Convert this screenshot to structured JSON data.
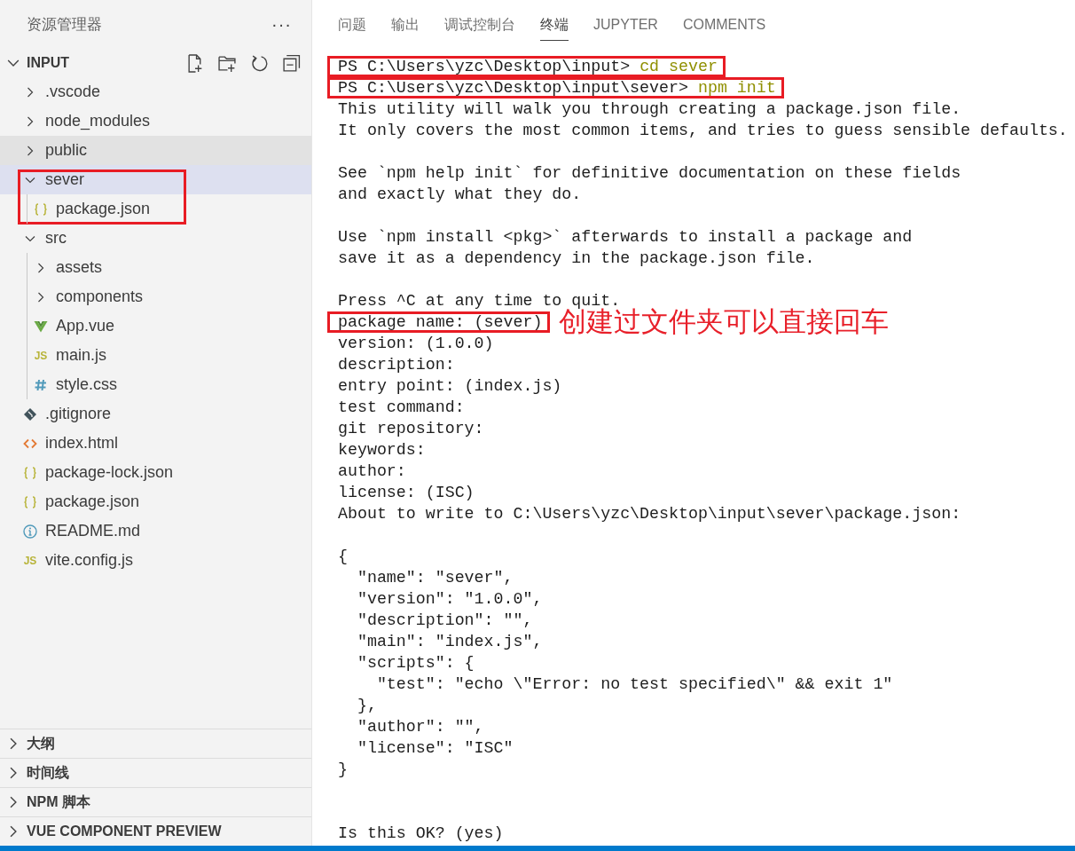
{
  "sidebar": {
    "title": "资源管理器",
    "more": "···",
    "folder": {
      "label": "INPUT",
      "expanded": true
    },
    "tree": [
      {
        "label": ".vscode",
        "kind": "folder",
        "expanded": false,
        "selected": false,
        "hovered": false,
        "boxed": false
      },
      {
        "label": "node_modules",
        "kind": "folder",
        "expanded": false,
        "selected": false,
        "hovered": false,
        "boxed": false
      },
      {
        "label": "public",
        "kind": "folder",
        "expanded": false,
        "selected": false,
        "hovered": true,
        "boxed": false
      },
      {
        "label": "sever",
        "kind": "folder",
        "expanded": true,
        "selected": true,
        "hovered": false,
        "boxed": true,
        "children": [
          {
            "label": "package.json",
            "kind": "json",
            "selected": false,
            "hovered": false,
            "boxed": false
          }
        ]
      },
      {
        "label": "src",
        "kind": "folder",
        "expanded": true,
        "selected": false,
        "hovered": false,
        "boxed": false,
        "children": [
          {
            "label": "assets",
            "kind": "folder",
            "expanded": false,
            "selected": false,
            "hovered": false,
            "boxed": false
          },
          {
            "label": "components",
            "kind": "folder",
            "expanded": false,
            "selected": false,
            "hovered": false,
            "boxed": false
          },
          {
            "label": "App.vue",
            "kind": "vue",
            "selected": false,
            "hovered": false,
            "boxed": false
          },
          {
            "label": "main.js",
            "kind": "js",
            "icon_text": "JS",
            "selected": false,
            "hovered": false,
            "boxed": false
          },
          {
            "label": "style.css",
            "kind": "css",
            "selected": false,
            "hovered": false,
            "boxed": false
          }
        ]
      },
      {
        "label": ".gitignore",
        "kind": "git",
        "selected": false,
        "hovered": false,
        "boxed": false
      },
      {
        "label": "index.html",
        "kind": "html",
        "selected": false,
        "hovered": false,
        "boxed": false
      },
      {
        "label": "package-lock.json",
        "kind": "json",
        "selected": false,
        "hovered": false,
        "boxed": false
      },
      {
        "label": "package.json",
        "kind": "json",
        "selected": false,
        "hovered": false,
        "boxed": false
      },
      {
        "label": "README.md",
        "kind": "info",
        "selected": false,
        "hovered": false,
        "boxed": false
      },
      {
        "label": "vite.config.js",
        "kind": "js",
        "icon_text": "JS",
        "selected": false,
        "hovered": false,
        "boxed": false
      }
    ],
    "sections": [
      {
        "label": "大纲",
        "expanded": false
      },
      {
        "label": "时间线",
        "expanded": false
      },
      {
        "label": "NPM 脚本",
        "expanded": false
      },
      {
        "label": "VUE COMPONENT PREVIEW",
        "expanded": false
      }
    ]
  },
  "panel": {
    "tabs": [
      {
        "label": "问题",
        "selected": false
      },
      {
        "label": "输出",
        "selected": false
      },
      {
        "label": "调试控制台",
        "selected": false
      },
      {
        "label": "终端",
        "selected": true
      },
      {
        "label": "JUPYTER",
        "selected": false
      },
      {
        "label": "COMMENTS",
        "selected": false
      }
    ],
    "lines": [
      {
        "kind": "prompt",
        "text": "PS C:\\Users\\yzc\\Desktop\\input>",
        "command": "cd sever",
        "boxed": true
      },
      {
        "kind": "prompt",
        "text": "PS C:\\Users\\yzc\\Desktop\\input\\sever>",
        "command": "npm init",
        "boxed": true
      },
      {
        "kind": "text",
        "text": "This utility will walk you through creating a package.json file.",
        "boxed": false
      },
      {
        "kind": "text",
        "text": "It only covers the most common items, and tries to guess sensible defaults.",
        "boxed": false
      },
      {
        "kind": "blank"
      },
      {
        "kind": "text",
        "text": "See `npm help init` for definitive documentation on these fields",
        "boxed": false
      },
      {
        "kind": "text",
        "text": "and exactly what they do.",
        "boxed": false
      },
      {
        "kind": "blank"
      },
      {
        "kind": "text",
        "text": "Use `npm install <pkg>` afterwards to install a package and",
        "boxed": false
      },
      {
        "kind": "text",
        "text": "save it as a dependency in the package.json file.",
        "boxed": false
      },
      {
        "kind": "blank"
      },
      {
        "kind": "text",
        "text": "Press ^C at any time to quit.",
        "boxed": false
      },
      {
        "kind": "text",
        "text": "package name: (sever)",
        "boxed": true,
        "note": "创建过文件夹可以直接回车"
      },
      {
        "kind": "text",
        "text": "version: (1.0.0)",
        "boxed": false
      },
      {
        "kind": "text",
        "text": "description:",
        "boxed": false
      },
      {
        "kind": "text",
        "text": "entry point: (index.js)",
        "boxed": false
      },
      {
        "kind": "text",
        "text": "test command:",
        "boxed": false
      },
      {
        "kind": "text",
        "text": "git repository:",
        "boxed": false
      },
      {
        "kind": "text",
        "text": "keywords:",
        "boxed": false
      },
      {
        "kind": "text",
        "text": "author:",
        "boxed": false
      },
      {
        "kind": "text",
        "text": "license: (ISC)",
        "boxed": false
      },
      {
        "kind": "text",
        "text": "About to write to C:\\Users\\yzc\\Desktop\\input\\sever\\package.json:",
        "boxed": false
      },
      {
        "kind": "blank"
      },
      {
        "kind": "text",
        "text": "{",
        "boxed": false
      },
      {
        "kind": "text",
        "text": "  \"name\": \"sever\",",
        "boxed": false
      },
      {
        "kind": "text",
        "text": "  \"version\": \"1.0.0\",",
        "boxed": false
      },
      {
        "kind": "text",
        "text": "  \"description\": \"\",",
        "boxed": false
      },
      {
        "kind": "text",
        "text": "  \"main\": \"index.js\",",
        "boxed": false
      },
      {
        "kind": "text",
        "text": "  \"scripts\": {",
        "boxed": false
      },
      {
        "kind": "text",
        "text": "    \"test\": \"echo \\\"Error: no test specified\\\" && exit 1\"",
        "boxed": false
      },
      {
        "kind": "text",
        "text": "  },",
        "boxed": false
      },
      {
        "kind": "text",
        "text": "  \"author\": \"\",",
        "boxed": false
      },
      {
        "kind": "text",
        "text": "  \"license\": \"ISC\"",
        "boxed": false
      },
      {
        "kind": "text",
        "text": "}",
        "boxed": false
      },
      {
        "kind": "blank"
      },
      {
        "kind": "blank"
      },
      {
        "kind": "text",
        "text": "Is this OK? (yes)",
        "boxed": false
      }
    ]
  }
}
